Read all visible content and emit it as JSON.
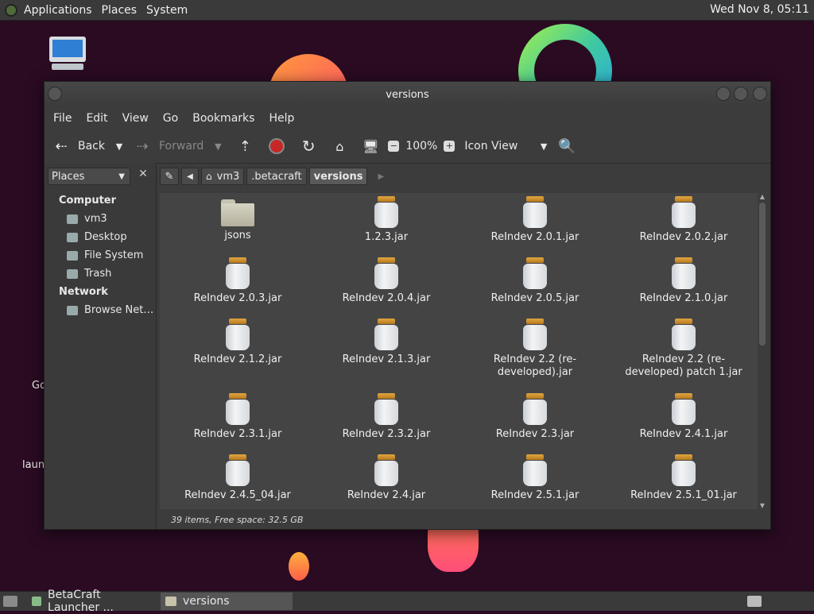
{
  "top_panel": {
    "menus": [
      "Applications",
      "Places",
      "System"
    ],
    "clock": "Wed Nov  8, 05:11"
  },
  "desktop": {
    "partial_labels": [
      "Go",
      "laun"
    ]
  },
  "window": {
    "title": "versions",
    "menubar": [
      "File",
      "Edit",
      "View",
      "Go",
      "Bookmarks",
      "Help"
    ],
    "toolbar": {
      "back_label": "Back",
      "forward_label": "Forward",
      "zoom": "100%",
      "view_mode": "Icon View"
    },
    "sidebar": {
      "combo_label": "Places",
      "headings": [
        "Computer",
        "Network"
      ],
      "computer_items": [
        "vm3",
        "Desktop",
        "File System",
        "Trash"
      ],
      "network_items": [
        "Browse Net…"
      ]
    },
    "pathbar": [
      "vm3",
      ".betacraft",
      "versions"
    ],
    "files": [
      {
        "name": "jsons",
        "type": "folder"
      },
      {
        "name": "1.2.3.jar",
        "type": "jar"
      },
      {
        "name": "ReIndev 2.0.1.jar",
        "type": "jar"
      },
      {
        "name": "ReIndev 2.0.2.jar",
        "type": "jar"
      },
      {
        "name": "ReIndev 2.0.3.jar",
        "type": "jar"
      },
      {
        "name": "ReIndev 2.0.4.jar",
        "type": "jar"
      },
      {
        "name": "ReIndev 2.0.5.jar",
        "type": "jar"
      },
      {
        "name": "ReIndev 2.1.0.jar",
        "type": "jar"
      },
      {
        "name": "ReIndev 2.1.2.jar",
        "type": "jar"
      },
      {
        "name": "ReIndev 2.1.3.jar",
        "type": "jar"
      },
      {
        "name": "ReIndev 2.2 (re-developed).jar",
        "type": "jar"
      },
      {
        "name": "ReIndev 2.2 (re-developed) patch 1.jar",
        "type": "jar"
      },
      {
        "name": "ReIndev 2.3.1.jar",
        "type": "jar"
      },
      {
        "name": "ReIndev 2.3.2.jar",
        "type": "jar"
      },
      {
        "name": "ReIndev 2.3.jar",
        "type": "jar"
      },
      {
        "name": "ReIndev 2.4.1.jar",
        "type": "jar"
      },
      {
        "name": "ReIndev 2.4.5_04.jar",
        "type": "jar"
      },
      {
        "name": "ReIndev 2.4.jar",
        "type": "jar"
      },
      {
        "name": "ReIndev 2.5.1.jar",
        "type": "jar"
      },
      {
        "name": "ReIndev 2.5.1_01.jar",
        "type": "jar"
      }
    ],
    "status": "39 items, Free space: 32.5 GB"
  },
  "taskbar": {
    "tasks": [
      "BetaCraft Launcher ...",
      "versions"
    ]
  }
}
